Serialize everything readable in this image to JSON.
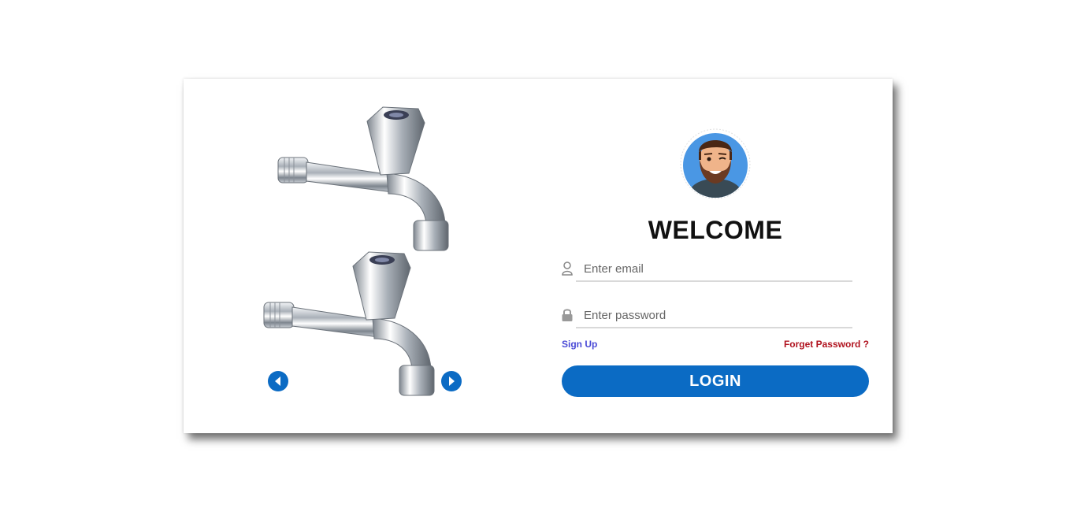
{
  "theme": {
    "accent": "#0b6bc4",
    "link": "#4a4ad6",
    "danger": "#b0121e",
    "avatar_bg": "#4a97e4"
  },
  "carousel": {
    "prev_icon": "caret-left-icon",
    "next_icon": "caret-right-icon",
    "image_subject": "chrome-bib-tap-faucet"
  },
  "login": {
    "avatar_icon": "avatar-bearded-man-icon",
    "title": "WELCOME",
    "email": {
      "icon": "user-icon",
      "placeholder": "Enter email",
      "value": ""
    },
    "password": {
      "icon": "lock-icon",
      "placeholder": "Enter password",
      "value": ""
    },
    "signup_label": "Sign Up",
    "forget_label": "Forget Password ?",
    "submit_label": "LOGIN"
  }
}
